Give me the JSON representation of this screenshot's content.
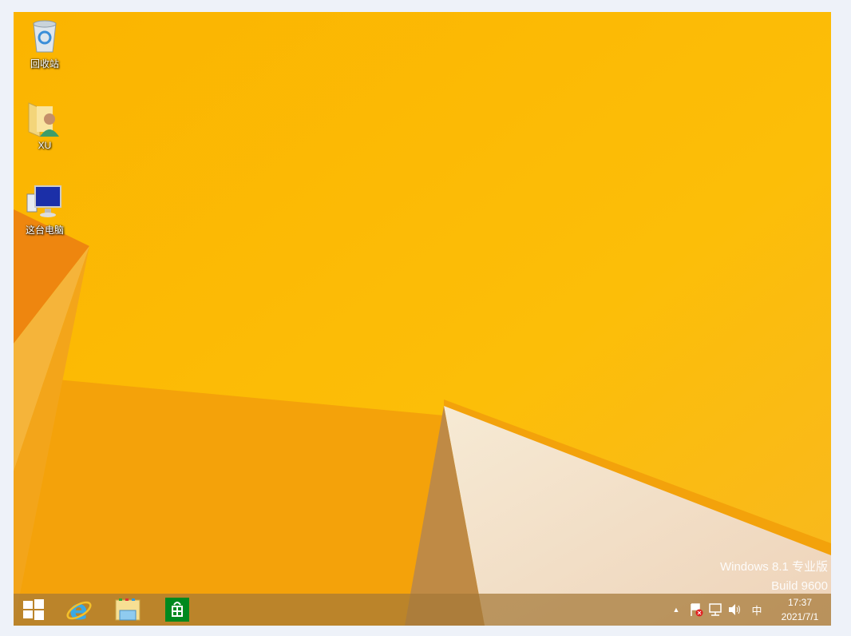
{
  "desktop": {
    "icons": [
      {
        "label": "回收站",
        "icon": "recycle-bin-icon"
      },
      {
        "label": "XU",
        "icon": "user-folder-icon"
      },
      {
        "label": "这台电脑",
        "icon": "this-pc-icon"
      }
    ]
  },
  "watermark": {
    "line1": "Windows 8.1 专业版",
    "line2": "Build 9600"
  },
  "taskbar": {
    "pinned": [
      "start-icon",
      "internet-explorer-icon",
      "file-explorer-icon",
      "store-icon"
    ],
    "tray": {
      "show_hidden": "▲",
      "ime": "中",
      "time": "17:37",
      "date": "2021/7/1"
    }
  },
  "colors": {
    "wallpaper": "#fbb900",
    "taskbar": "#a57837",
    "store": "#00891e"
  }
}
